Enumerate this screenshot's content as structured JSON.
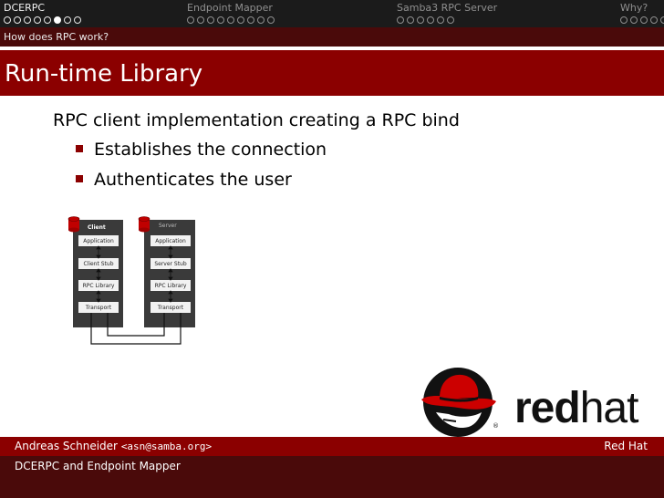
{
  "nav": {
    "sections": [
      {
        "title": "DCERPC",
        "dots": 8,
        "active_dot": 5
      },
      {
        "title": "Endpoint Mapper",
        "dots": 9,
        "active_dot": -1
      },
      {
        "title": "Samba3 RPC Server",
        "dots": 6,
        "active_dot": -1
      },
      {
        "title": "Why?",
        "dots": 5,
        "active_dot": -1
      }
    ],
    "subsection": "How does RPC work?"
  },
  "slide": {
    "title": "Run-time Library",
    "main_bullet": "RPC client implementation creating a RPC bind",
    "sub_bullets": [
      "Establishes the connection",
      "Authenticates the user"
    ]
  },
  "diagram": {
    "client_header": "Client",
    "server_header": "Server",
    "client_boxes": [
      "Application",
      "Client Stub",
      "RPC Library",
      "Transport"
    ],
    "server_boxes": [
      "Application",
      "Server Stub",
      "RPC Library",
      "Transport"
    ]
  },
  "logo": {
    "bold": "red",
    "regular": "hat",
    "mark": "®"
  },
  "footer": {
    "author_name": "Andreas Schneider",
    "author_email": "<asn@samba.org>",
    "org": "Red Hat",
    "talk_title": "DCERPC and Endpoint Mapper"
  },
  "colors": {
    "accent": "#8b0000",
    "dark": "#4a0a0a",
    "nav": "#1b1b1b"
  }
}
